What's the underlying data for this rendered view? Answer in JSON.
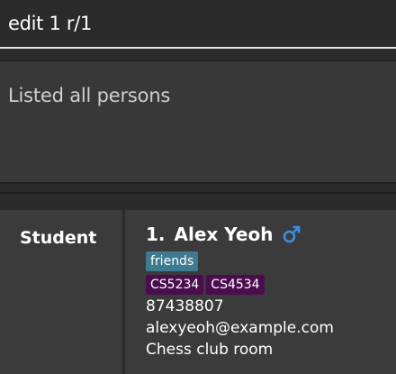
{
  "command_box": {
    "value": "edit 1 r/1"
  },
  "result_display": {
    "text": "Listed all persons"
  },
  "person_list": {
    "role_label": "Student",
    "persons": [
      {
        "index": "1.",
        "name": "Alex Yeoh",
        "gender_icon": "male-symbol-icon",
        "tags": [
          "friends"
        ],
        "modules": [
          "CS5234",
          "CS4534"
        ],
        "phone": "87438807",
        "email": "alexyeoh@example.com",
        "address": "Chess club room"
      }
    ]
  },
  "colors": {
    "background": "#2b2b2b",
    "panel": "#383838",
    "card": "#3b3b3b",
    "tag_friends": "#3e7b91",
    "tag_module": "#4a0e4e",
    "gender_icon": "#3a8ee6"
  }
}
